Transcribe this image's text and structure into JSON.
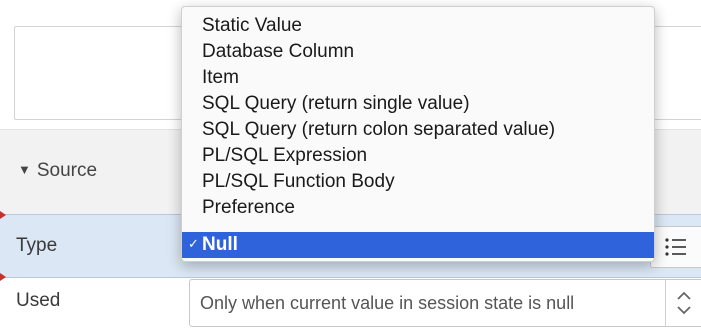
{
  "source_section": {
    "toggle_icon": "triangle-down-icon",
    "title": "Source"
  },
  "type_row": {
    "label": "Type",
    "list_icon": "list-icon"
  },
  "used_row": {
    "label": "Used",
    "value": "Only when current value in session state is null",
    "stepper_icon": "up-down-chevron-icon"
  },
  "type_dropdown": {
    "options": [
      {
        "label": "Static Value"
      },
      {
        "label": "Database Column"
      },
      {
        "label": "Item"
      },
      {
        "label": "SQL Query (return single value)"
      },
      {
        "label": "SQL Query (return colon separated value)"
      },
      {
        "label": "PL/SQL Expression"
      },
      {
        "label": "PL/SQL Function Body"
      },
      {
        "label": "Preference"
      },
      {
        "label": "Null",
        "checkmark": "✓"
      }
    ],
    "selected_index": 8,
    "highlight_color": "#2f63dc"
  }
}
